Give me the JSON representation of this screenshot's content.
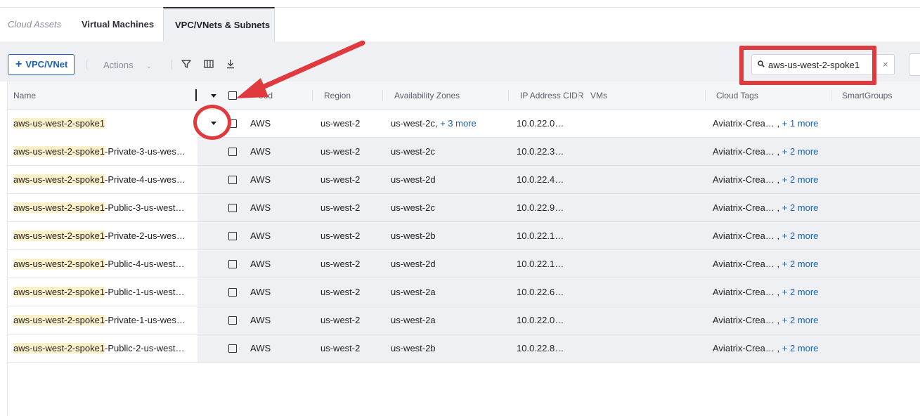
{
  "tabs": [
    {
      "label": "Cloud Assets"
    },
    {
      "label": "Virtual Machines"
    },
    {
      "label": "VPC/VNets & Subnets"
    }
  ],
  "toolbar": {
    "add_label": "VPC/VNet",
    "actions_label": "Actions",
    "search_value": "aws-us-west-2-spoke1",
    "clear_label": "×"
  },
  "columns": [
    "Name",
    "Cloud",
    "Region",
    "Availability Zones",
    "IP Address CIDR",
    "VMs",
    "Cloud Tags",
    "SmartGroups"
  ],
  "column_partial": {
    "cloud": "oud"
  },
  "highlight": "aws-us-west-2-spoke1",
  "rows": [
    {
      "suffix": "",
      "cloud": "AWS",
      "region": "us-west-2",
      "az": "us-west-2c,",
      "az_more": "+ 3 more",
      "cidr": "10.0.22.0…",
      "vms": "",
      "tags": "Aviatrix-Crea… ,",
      "tags_more": "+ 1 more"
    },
    {
      "suffix": "-Private-3-us-wes…",
      "cloud": "AWS",
      "region": "us-west-2",
      "az": "us-west-2c",
      "az_more": "",
      "cidr": "10.0.22.3…",
      "vms": "",
      "tags": "Aviatrix-Crea… ,",
      "tags_more": "+ 2 more"
    },
    {
      "suffix": "-Private-4-us-wes…",
      "cloud": "AWS",
      "region": "us-west-2",
      "az": "us-west-2d",
      "az_more": "",
      "cidr": "10.0.22.4…",
      "vms": "",
      "tags": "Aviatrix-Crea… ,",
      "tags_more": "+ 2 more"
    },
    {
      "suffix": "-Public-3-us-west…",
      "cloud": "AWS",
      "region": "us-west-2",
      "az": "us-west-2c",
      "az_more": "",
      "cidr": "10.0.22.9…",
      "vms": "",
      "tags": "Aviatrix-Crea… ,",
      "tags_more": "+ 2 more"
    },
    {
      "suffix": "-Private-2-us-wes…",
      "cloud": "AWS",
      "region": "us-west-2",
      "az": "us-west-2b",
      "az_more": "",
      "cidr": "10.0.22.1…",
      "vms": "",
      "tags": "Aviatrix-Crea… ,",
      "tags_more": "+ 2 more"
    },
    {
      "suffix": "-Public-4-us-west…",
      "cloud": "AWS",
      "region": "us-west-2",
      "az": "us-west-2d",
      "az_more": "",
      "cidr": "10.0.22.1…",
      "vms": "",
      "tags": "Aviatrix-Crea… ,",
      "tags_more": "+ 2 more"
    },
    {
      "suffix": "-Public-1-us-west…",
      "cloud": "AWS",
      "region": "us-west-2",
      "az": "us-west-2a",
      "az_more": "",
      "cidr": "10.0.22.6…",
      "vms": "",
      "tags": "Aviatrix-Crea… ,",
      "tags_more": "+ 2 more"
    },
    {
      "suffix": "-Private-1-us-wes…",
      "cloud": "AWS",
      "region": "us-west-2",
      "az": "us-west-2a",
      "az_more": "",
      "cidr": "10.0.22.0…",
      "vms": "",
      "tags": "Aviatrix-Crea… ,",
      "tags_more": "+ 2 more"
    },
    {
      "suffix": "-Public-2-us-west…",
      "cloud": "AWS",
      "region": "us-west-2",
      "az": "us-west-2b",
      "az_more": "",
      "cidr": "10.0.22.8…",
      "vms": "",
      "tags": "Aviatrix-Crea… ,",
      "tags_more": "+ 2 more"
    }
  ],
  "colors": {
    "accent": "#1b5fb0",
    "annotation": "#e03a3e",
    "highlight": "#fbf0c9"
  }
}
